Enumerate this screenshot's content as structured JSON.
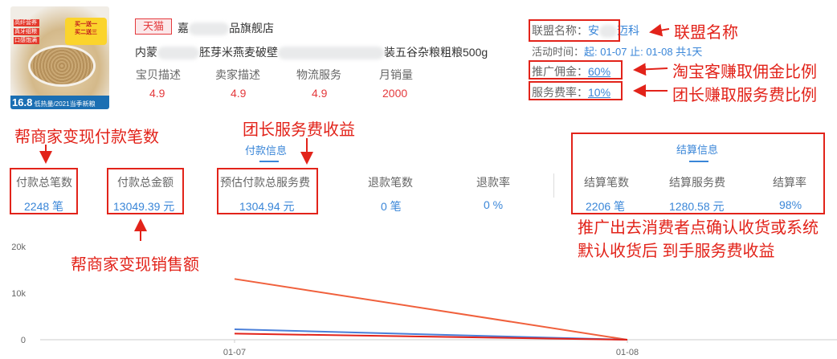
{
  "product": {
    "image": {
      "tags": [
        "高纤营养",
        "真牙组粮",
        "口感饱满"
      ],
      "promo_line1": "买一送一",
      "promo_line2": "买二送三",
      "price": "16.8",
      "price_note": "低热量/2021当季新粮"
    },
    "platform_badge": "天猫",
    "shop_name_prefix": "嘉",
    "shop_name_suffix": "品旗舰店",
    "title_prefix": "内蒙",
    "title_middle": "胚芽米燕麦破壁",
    "title_suffix": "装五谷杂粮粗粮500g",
    "scores": [
      {
        "label": "宝贝描述",
        "value": "4.9"
      },
      {
        "label": "卖家描述",
        "value": "4.9"
      },
      {
        "label": "物流服务",
        "value": "4.9"
      },
      {
        "label": "月销量",
        "value": "2000"
      }
    ],
    "alliance_label": "联盟名称：",
    "alliance_value_prefix": "安",
    "alliance_value_suffix": "迈科",
    "activity_label": "活动时间：",
    "activity_value": "起: 01-07 止: 01-08 共1天",
    "commission_label": "推广佣金：",
    "commission_value": "60%",
    "service_rate_label": "服务费率：",
    "service_rate_value": "10%"
  },
  "tabs": {
    "payment": "付款信息",
    "settlement": "结算信息"
  },
  "payment_stats": [
    {
      "label": "付款总笔数",
      "value": "2248 笔"
    },
    {
      "label": "付款总金额",
      "value": "13049.39 元"
    },
    {
      "label": "预估付款总服务费",
      "value": "1304.94 元"
    },
    {
      "label": "退款笔数",
      "value": "0 笔"
    },
    {
      "label": "退款率",
      "value": "0 %"
    }
  ],
  "settlement_stats": [
    {
      "label": "结算笔数",
      "value": "2206 笔"
    },
    {
      "label": "结算服务费",
      "value": "1280.58 元"
    },
    {
      "label": "结算率",
      "value": "98%"
    }
  ],
  "annotations": {
    "alliance": "联盟名称",
    "commission": "淘宝客赚取佣金比例",
    "service_rate": "团长赚取服务费比例",
    "pay_count": "帮商家变现付款笔数",
    "service_income": "团长服务费收益",
    "sales_amount": "帮商家变现销售额",
    "settlement_line1": "推广出去消费者点确认收货或系统",
    "settlement_line2": "默认收货后 到手服务费收益"
  },
  "colors": {
    "accent_blue": "#3a86d8",
    "annotation_red": "#e2231a",
    "price_red": "#e4393c",
    "line_orange": "#f0603c",
    "line_blue": "#4a7fd9",
    "line_red": "#e2231a"
  },
  "chart_data": {
    "type": "line",
    "x": [
      "01-07",
      "01-08"
    ],
    "y_ticks": [
      "0",
      "10k",
      "20k"
    ],
    "ylim": [
      0,
      20000
    ],
    "series": [
      {
        "values": [
          13049.39,
          0
        ],
        "color": "#f0603c"
      },
      {
        "values": [
          2248,
          0
        ],
        "color": "#4a7fd9"
      },
      {
        "values": [
          1304.94,
          0
        ],
        "color": "#e2231a"
      }
    ],
    "grid": false
  }
}
